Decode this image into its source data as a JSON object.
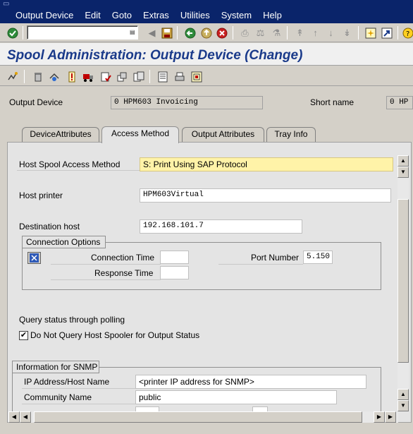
{
  "menu": {
    "items": [
      {
        "id": "output-device",
        "label": "Output Device"
      },
      {
        "id": "edit",
        "label": "Edit"
      },
      {
        "id": "goto",
        "label": "Goto"
      },
      {
        "id": "extras",
        "label": "Extras"
      },
      {
        "id": "utilities",
        "label": "Utilities"
      },
      {
        "id": "system",
        "label": "System"
      },
      {
        "id": "help",
        "label": "Help"
      }
    ]
  },
  "command_field": {
    "value": ""
  },
  "page_title": "Spool Administration: Output Device (Change)",
  "header": {
    "output_device_label": "Output Device",
    "output_device_value": "0 HPM603 Invoicing",
    "short_name_label": "Short name",
    "short_name_value": "0 HP"
  },
  "tabs": [
    {
      "label": "DeviceAttributes",
      "active": false
    },
    {
      "label": "Access Method",
      "active": true
    },
    {
      "label": "Output Attributes",
      "active": false
    },
    {
      "label": "Tray Info",
      "active": false
    }
  ],
  "access_method": {
    "host_spool_label": "Host Spool Access Method",
    "host_spool_value": "S: Print Using SAP Protocol",
    "host_printer_label": "Host printer",
    "host_printer_value": "HPM603Virtual",
    "destination_host_label": "Destination host",
    "destination_host_value": "192.168.101.7"
  },
  "connection_options": {
    "title": "Connection Options",
    "connection_time_label": "Connection Time",
    "connection_time_value": "",
    "response_time_label": "Response Time",
    "response_time_value": "",
    "port_number_label": "Port Number",
    "port_number_value": "5.150"
  },
  "polling": {
    "heading": "Query status through polling",
    "checkbox_label": "Do Not Query Host Spooler for Output Status",
    "checkbox_checked": true,
    "checkbox_glyph": "✔"
  },
  "snmp": {
    "title": "Information for SNMP",
    "ip_label": "IP Address/Host Name",
    "ip_value": "<printer IP address for SNMP>",
    "community_label": "Community Name",
    "community_value": "public"
  },
  "colors": {
    "title_bar": "#0a246a",
    "page_title_text": "#1a3a8a",
    "highlight_field": "#fff3a8"
  }
}
